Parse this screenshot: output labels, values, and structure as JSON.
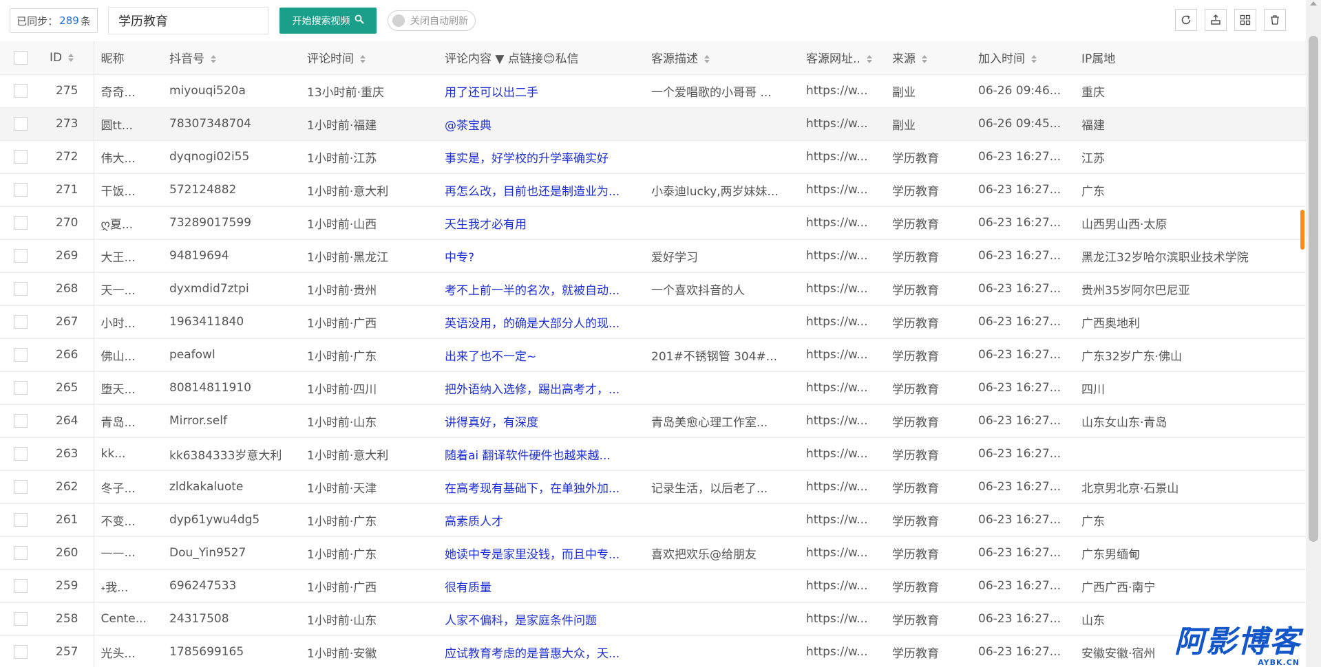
{
  "toolbar": {
    "synced_label": "已同步：",
    "synced_count": "289",
    "synced_unit": "条",
    "search_value": "学历教育",
    "search_button": "开始搜索视频",
    "auto_refresh_label": "关闭自动刷新",
    "icons": [
      "refresh-icon",
      "export-icon",
      "columns-grid-icon",
      "trash-icon"
    ]
  },
  "table": {
    "columns": [
      "ID",
      "昵称",
      "抖音号",
      "评论时间",
      "评论内容 ▼ 点链接😊私信",
      "客源描述",
      "客源网址..",
      "来源",
      "加入时间",
      "IP属地"
    ],
    "rows": [
      {
        "id": "275",
        "nick": "奇奇...",
        "douyin": "miyouqi520a",
        "time": "13小时前·重庆",
        "comment": "用了还可以出二手",
        "desc": "一个爱唱歌的小哥哥 ...",
        "url": "https://w...",
        "source": "副业",
        "added": "06-26 09:46...",
        "ip": "重庆"
      },
      {
        "id": "273",
        "nick": "圆tt...",
        "douyin": "78307348704",
        "time": "1小时前·福建",
        "comment": "@茶宝典",
        "desc": "",
        "url": "https://w...",
        "source": "副业",
        "added": "06-26 09:45...",
        "ip": "福建"
      },
      {
        "id": "272",
        "nick": "伟大...",
        "douyin": "dyqnogi02i55",
        "time": "1小时前·江苏",
        "comment": "事实是，好学校的升学率确实好",
        "desc": "",
        "url": "https://w...",
        "source": "学历教育",
        "added": "06-23 16:27...",
        "ip": "江苏"
      },
      {
        "id": "271",
        "nick": "干饭...",
        "douyin": "572124882",
        "time": "1小时前·意大利",
        "comment": "再怎么改，目前也还是制造业为...",
        "desc": "小泰迪lucky,两岁妹妹...",
        "url": "https://w...",
        "source": "学历教育",
        "added": "06-23 16:27...",
        "ip": "广东"
      },
      {
        "id": "270",
        "nick": "ღ夏...",
        "douyin": "73289017599",
        "time": "1小时前·山西",
        "comment": "天生我才必有用",
        "desc": "",
        "url": "https://w...",
        "source": "学历教育",
        "added": "06-23 16:27...",
        "ip": "山西男山西·太原"
      },
      {
        "id": "269",
        "nick": "大王...",
        "douyin": "94819694",
        "time": "1小时前·黑龙江",
        "comment": "中专?",
        "desc": "爱好学习",
        "url": "https://w...",
        "source": "学历教育",
        "added": "06-23 16:27...",
        "ip": "黑龙江32岁哈尔滨职业技术学院"
      },
      {
        "id": "268",
        "nick": "天一...",
        "douyin": "dyxmdid7ztpi",
        "time": "1小时前·贵州",
        "comment": "考不上前一半的名次，就被自动...",
        "desc": "一个喜欢抖音的人",
        "url": "https://w...",
        "source": "学历教育",
        "added": "06-23 16:27...",
        "ip": "贵州35岁阿尔巴尼亚"
      },
      {
        "id": "267",
        "nick": "小时...",
        "douyin": "1963411840",
        "time": "1小时前·广西",
        "comment": "英语没用，的确是大部分人的现...",
        "desc": "",
        "url": "https://w...",
        "source": "学历教育",
        "added": "06-23 16:27...",
        "ip": "广西奥地利"
      },
      {
        "id": "266",
        "nick": "佛山...",
        "douyin": "peafowl",
        "time": "1小时前·广东",
        "comment": "出来了也不一定~",
        "desc": "201#不锈钢管 304#...",
        "url": "https://w...",
        "source": "学历教育",
        "added": "06-23 16:27...",
        "ip": "广东32岁广东·佛山"
      },
      {
        "id": "265",
        "nick": "堕天...",
        "douyin": "80814811910",
        "time": "1小时前·四川",
        "comment": "把外语纳入选修，踢出高考才，...",
        "desc": "",
        "url": "https://w...",
        "source": "学历教育",
        "added": "06-23 16:27...",
        "ip": "四川"
      },
      {
        "id": "264",
        "nick": "青岛...",
        "douyin": "Mirror.self",
        "time": "1小时前·山东",
        "comment": "讲得真好，有深度",
        "desc": "青岛美愈心理工作室...",
        "url": "https://w...",
        "source": "学历教育",
        "added": "06-23 16:27...",
        "ip": "山东女山东·青岛"
      },
      {
        "id": "263",
        "nick": "kk...",
        "douyin": "kk6384333岁意大利",
        "time": "1小时前·意大利",
        "comment": "随着ai 翻译软件硬件也越来越...",
        "desc": "",
        "url": "https://w...",
        "source": "学历教育",
        "added": "06-23 16:27...",
        "ip": ""
      },
      {
        "id": "262",
        "nick": "冬子...",
        "douyin": "zldkakaluote",
        "time": "1小时前·天津",
        "comment": "在高考现有基础下，在单独外加...",
        "desc": "记录生活，以后老了...",
        "url": "https://w...",
        "source": "学历教育",
        "added": "06-23 16:27...",
        "ip": "北京男北京·石景山"
      },
      {
        "id": "261",
        "nick": "不变...",
        "douyin": "dyp61ywu4dg5",
        "time": "1小时前·广东",
        "comment": "高素质人才",
        "desc": "",
        "url": "https://w...",
        "source": "学历教育",
        "added": "06-23 16:27...",
        "ip": "广东"
      },
      {
        "id": "260",
        "nick": "——...",
        "douyin": "Dou_Yin9527",
        "time": "1小时前·广东",
        "comment": "她读中专是家里没钱，而且中专...",
        "desc": "喜欢把欢乐@给朋友",
        "url": "https://w...",
        "source": "学历教育",
        "added": "06-23 16:27...",
        "ip": "广东男缅甸"
      },
      {
        "id": "259",
        "nick": "˖我...",
        "douyin": "696247533",
        "time": "1小时前·广西",
        "comment": "很有质量",
        "desc": "",
        "url": "https://w...",
        "source": "学历教育",
        "added": "06-23 16:27...",
        "ip": "广西广西·南宁"
      },
      {
        "id": "258",
        "nick": "Cente...",
        "douyin": "24317508",
        "time": "1小时前·山东",
        "comment": "人家不偏科，是家庭条件问题",
        "desc": "",
        "url": "https://w...",
        "source": "学历教育",
        "added": "06-23 16:27...",
        "ip": "山东"
      },
      {
        "id": "257",
        "nick": "光头...",
        "douyin": "1785699165",
        "time": "1小时前·安徽",
        "comment": "应试教育考虑的是普惠大众，天...",
        "desc": "",
        "url": "https://w...",
        "source": "学历教育",
        "added": "06-23 16:27...",
        "ip": "安徽安徽·宿州"
      }
    ]
  },
  "watermark": {
    "big": "阿影博客",
    "small": "AYBK.CN"
  },
  "colors": {
    "primary": "#1aa08a",
    "link": "#1f2fd6",
    "count": "#1e6fd9",
    "scroll_accent": "#ff8c1a"
  }
}
